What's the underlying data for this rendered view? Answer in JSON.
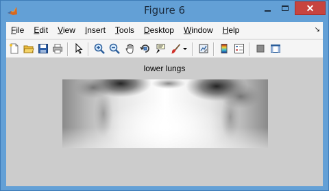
{
  "window": {
    "title": "Figure 6",
    "close_glyph": "✕"
  },
  "menu": {
    "items": [
      {
        "label": "File"
      },
      {
        "label": "Edit"
      },
      {
        "label": "View"
      },
      {
        "label": "Insert"
      },
      {
        "label": "Tools"
      },
      {
        "label": "Desktop"
      },
      {
        "label": "Window"
      },
      {
        "label": "Help"
      }
    ],
    "overflow_glyph": "↘"
  },
  "toolbar": {
    "icons": [
      "new-figure-icon",
      "open-file-icon",
      "save-icon",
      "print-icon",
      "edit-plot-icon",
      "zoom-in-icon",
      "zoom-out-icon",
      "pan-icon",
      "rotate-3d-icon",
      "data-cursor-icon",
      "brush-icon",
      "link-plot-icon",
      "colorbar-icon",
      "legend-icon",
      "hide-plot-tools-icon",
      "show-plot-tools-icon"
    ]
  },
  "figure": {
    "title": "lower lungs",
    "background_color": "#cccccc"
  }
}
